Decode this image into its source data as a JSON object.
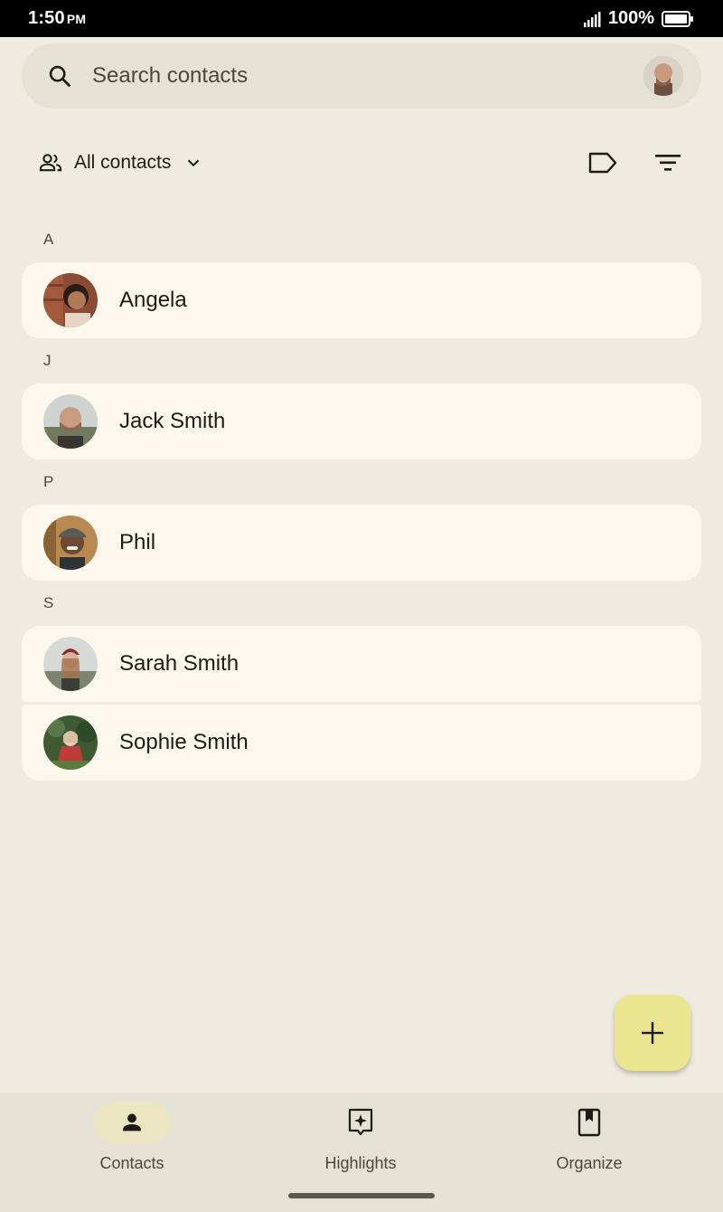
{
  "status_bar": {
    "time": "1:50",
    "ampm": "PM",
    "battery": "100%"
  },
  "search": {
    "placeholder": "Search contacts"
  },
  "filter": {
    "label": "All contacts"
  },
  "sections": [
    {
      "letter": "A",
      "contacts": [
        "Angela"
      ]
    },
    {
      "letter": "J",
      "contacts": [
        "Jack Smith"
      ]
    },
    {
      "letter": "P",
      "contacts": [
        "Phil"
      ]
    },
    {
      "letter": "S",
      "contacts": [
        "Sarah Smith",
        "Sophie Smith"
      ]
    }
  ],
  "bottom_nav": [
    {
      "label": "Contacts",
      "icon": "person-icon",
      "active": true
    },
    {
      "label": "Highlights",
      "icon": "highlights-icon",
      "active": false
    },
    {
      "label": "Organize",
      "icon": "bookmark-icon",
      "active": false
    }
  ],
  "colors": {
    "background": "#efebe0",
    "card": "#fdf8ed",
    "fab": "#ebe58f",
    "active_pill": "#ebe6c1"
  }
}
